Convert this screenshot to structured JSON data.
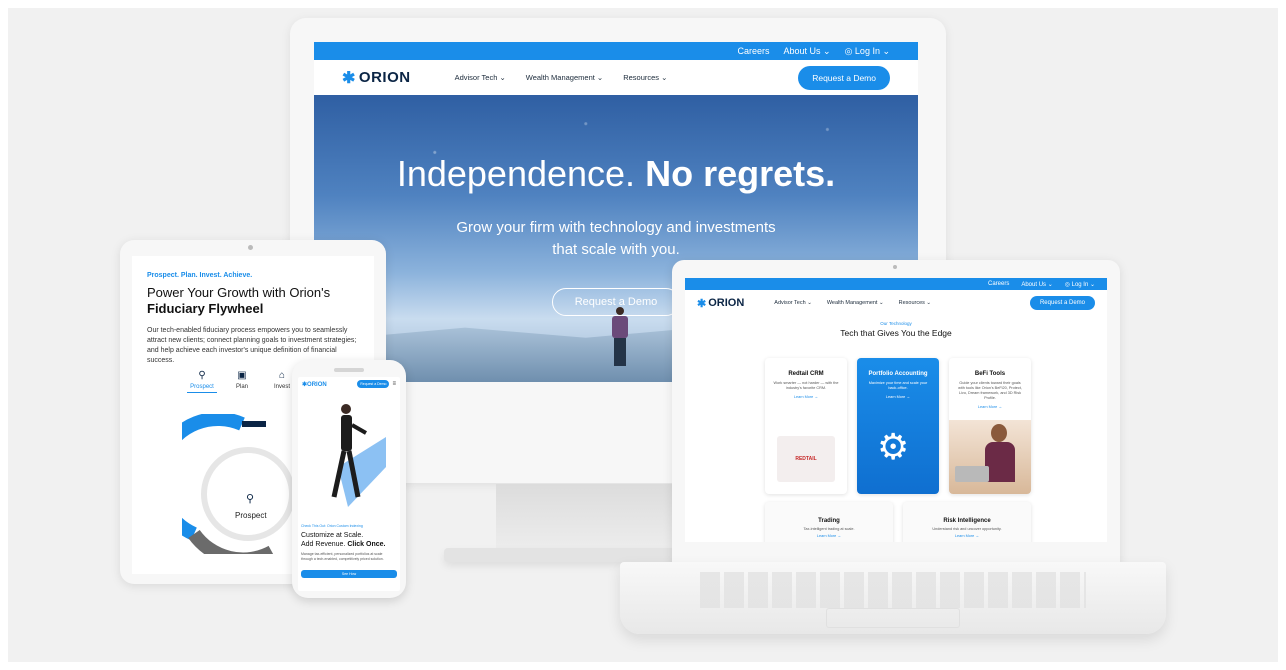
{
  "desktop": {
    "topbar": {
      "careers": "Careers",
      "about": "About Us ⌄",
      "login": "◎ Log In ⌄"
    },
    "nav": {
      "logo": "ORION",
      "links": [
        "Advisor Tech ⌄",
        "Wealth Management ⌄",
        "Resources ⌄"
      ],
      "demo": "Request a Demo"
    },
    "hero": {
      "title_light": "Independence.",
      "title_bold": "No regrets.",
      "subtitle_line1": "Grow your firm with technology and investments",
      "subtitle_line2": "that scale with you.",
      "cta": "Request a Demo"
    }
  },
  "tablet": {
    "kicker": "Prospect. Plan. Invest. Achieve.",
    "title_line1": "Power Your Growth with Orion's",
    "title_line2": "Fiduciary Flywheel",
    "body": "Our tech-enabled fiduciary process empowers you to seamlessly attract new clients; connect planning goals to investment strategies; and help achieve each investor's unique definition of financial success.",
    "tabs": [
      {
        "label": "Prospect",
        "icon": "⚲"
      },
      {
        "label": "Plan",
        "icon": "▣"
      },
      {
        "label": "Invest",
        "icon": "⌂"
      }
    ],
    "ring_label": "Prospect"
  },
  "phone": {
    "logo": "ORION",
    "demo": "Request a Demo",
    "kicker": "Check This Out: Orion Custom Indexing",
    "title_line1": "Customize at Scale.",
    "title_line2_a": "Add Revenue.",
    "title_line2_b": "Click Once.",
    "body": "Manage tax-efficient, personalized portfolios at scale through a tech-enabled, competitively priced solution.",
    "cta": "See How"
  },
  "laptop": {
    "topbar": {
      "careers": "Careers",
      "about": "About Us ⌄",
      "login": "◎ Log In ⌄"
    },
    "nav": {
      "logo": "ORION",
      "links": [
        "Advisor Tech ⌄",
        "Wealth Management ⌄",
        "Resources ⌄"
      ],
      "demo": "Request a Demo"
    },
    "kicker": "Our Technology",
    "title": "Tech that Gives You the Edge",
    "cards": [
      {
        "title": "Redtail CRM",
        "body": "Work smarter — not harder — with the industry's favorite CRM.",
        "link": "Learn More →",
        "badge": "REDTAIL"
      },
      {
        "title": "Portfolio Accounting",
        "body": "Maximize your time and scale your back-office.",
        "link": "Learn More →"
      },
      {
        "title": "BeFi Tools",
        "body": "Guide your clients toward their goals with tools like Orion's BeFi20, Protect, Livo, Dream framework, and 3D Risk Profile.",
        "link": "Learn More →"
      }
    ],
    "wide_cards": [
      {
        "title": "Trading",
        "body": "Tax-intelligent trading at scale.",
        "link": "Learn More →"
      },
      {
        "title": "Risk Intelligence",
        "body": "Understand risk and uncover opportunity.",
        "link": "Learn More →"
      }
    ]
  }
}
